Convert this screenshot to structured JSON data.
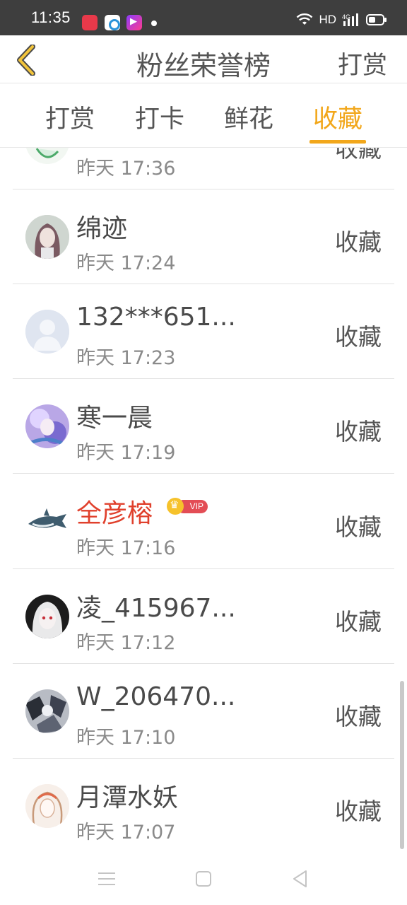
{
  "status_bar": {
    "time": "11:35",
    "network": "HD",
    "signal_label": "4G"
  },
  "header": {
    "title": "粉丝荣誉榜",
    "action_label": "打赏"
  },
  "tabs": [
    {
      "label": "打赏",
      "active": false
    },
    {
      "label": "打卡",
      "active": false
    },
    {
      "label": "鲜花",
      "active": false
    },
    {
      "label": "收藏",
      "active": true
    }
  ],
  "accent_color": "#f2a71b",
  "vip_name_color": "#e0402c",
  "list": {
    "items": [
      {
        "name": "",
        "time": "昨天 17:36",
        "action": "收藏",
        "avatar": "avatar-green-partial"
      },
      {
        "name": "绵迹",
        "time": "昨天 17:24",
        "action": "收藏",
        "avatar": "avatar-anime-girl"
      },
      {
        "name": "132***651...",
        "time": "昨天 17:23",
        "action": "收藏",
        "avatar": "avatar-default-user"
      },
      {
        "name": "寒一晨",
        "time": "昨天 17:19",
        "action": "收藏",
        "avatar": "avatar-purple-art"
      },
      {
        "name": "全彦榕",
        "time": "昨天 17:16",
        "action": "收藏",
        "avatar": "avatar-shark",
        "vip": true,
        "vip_label": "VIP"
      },
      {
        "name": "凌_415967...",
        "time": "昨天 17:12",
        "action": "收藏",
        "avatar": "avatar-white-hair"
      },
      {
        "name": "W_206470...",
        "time": "昨天 17:10",
        "action": "收藏",
        "avatar": "avatar-monochrome"
      },
      {
        "name": "月潭水妖",
        "time": "昨天 17:07",
        "action": "收藏",
        "avatar": "avatar-sketch-girl"
      }
    ]
  }
}
